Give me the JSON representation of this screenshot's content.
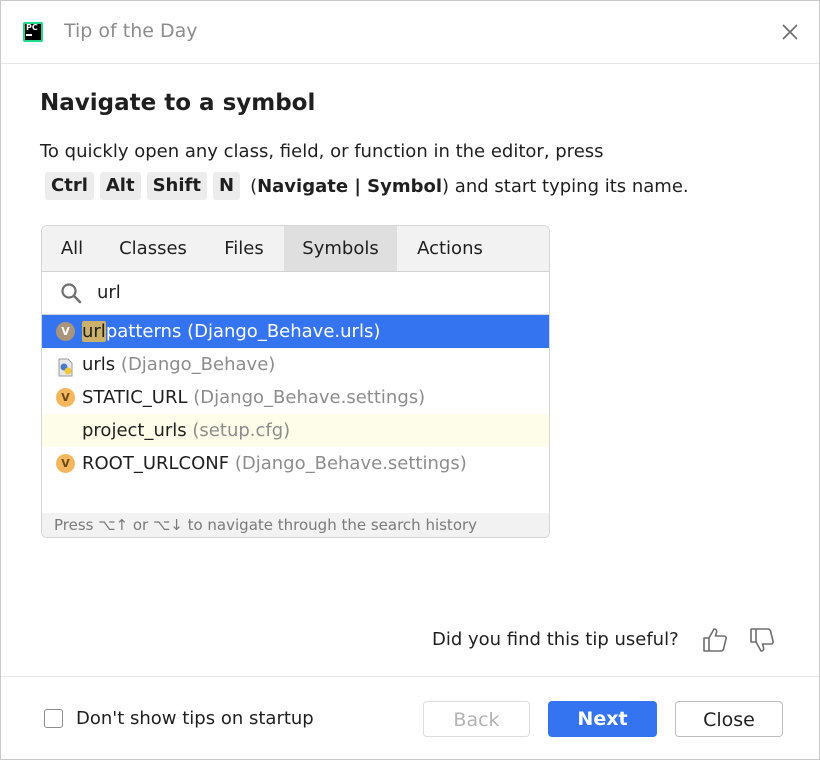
{
  "window": {
    "title": "Tip of the Day",
    "app_icon_text": "PC"
  },
  "tip": {
    "heading": "Navigate to a symbol",
    "description": "To quickly open any class, field, or function in the editor, press",
    "keys": [
      "Ctrl",
      "Alt",
      "Shift",
      "N"
    ],
    "action_prefix": "(",
    "action_name": "Navigate | Symbol",
    "action_suffix": ") and start typing its name."
  },
  "search_panel": {
    "tabs": [
      {
        "label": "All",
        "active": false
      },
      {
        "label": "Classes",
        "active": false
      },
      {
        "label": "Files",
        "active": false
      },
      {
        "label": "Symbols",
        "active": true
      },
      {
        "label": "Actions",
        "active": false
      }
    ],
    "query": "url",
    "results": [
      {
        "match": "url",
        "rest": "patterns",
        "location": "(Django_Behave.urls)",
        "icon": "variable-icon",
        "selected": true
      },
      {
        "match": "",
        "rest": "urls",
        "location": "(Django_Behave)",
        "icon": "python-file-icon",
        "selected": false
      },
      {
        "match": "",
        "rest": "STATIC_URL",
        "location": "(Django_Behave.settings)",
        "icon": "variable-icon",
        "selected": false
      },
      {
        "match": "",
        "rest": "project_urls",
        "location": "(setup.cfg)",
        "icon": "none",
        "selected": false,
        "highlighted": true
      },
      {
        "match": "",
        "rest": "ROOT_URLCONF",
        "location": "(Django_Behave.settings)",
        "icon": "variable-icon",
        "selected": false
      }
    ],
    "variable_badge": "V",
    "history_hint": "Press ⌥↑ or ⌥↓ to navigate through the search history"
  },
  "feedback": {
    "question": "Did you find this tip useful?"
  },
  "footer": {
    "checkbox_label": "Don't show tips on startup",
    "checkbox_checked": false,
    "back_label": "Back",
    "next_label": "Next",
    "close_label": "Close"
  },
  "colors": {
    "accent": "#3574f0",
    "selection": "#3574f0",
    "match_highlight": "#cbb169",
    "variable_icon": "#f4b75d"
  }
}
